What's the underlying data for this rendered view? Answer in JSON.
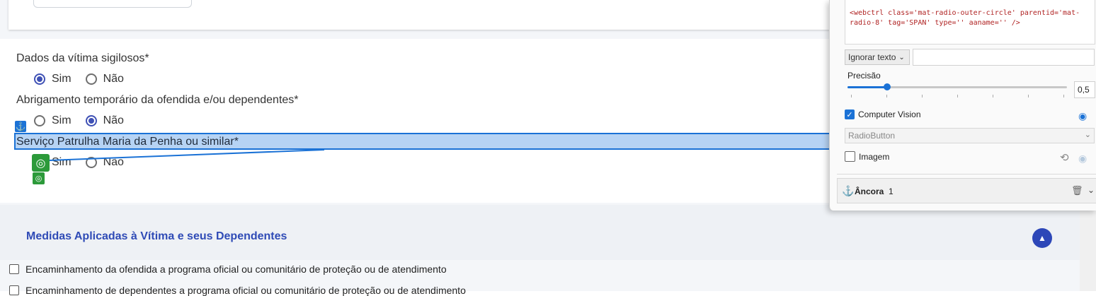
{
  "form": {
    "q1_label": "Dados da vítima sigilosos*",
    "q1_options": [
      "Sim",
      "Não"
    ],
    "q1_selected": "Sim",
    "q2_label": "Abrigamento temporário da ofendida e/ou dependentes*",
    "q2_options": [
      "Sim",
      "Não"
    ],
    "q2_selected": "Não",
    "q3_label": "Serviço Patrulha Maria da Penha ou similar*",
    "q3_options": [
      "Sim",
      "Não"
    ]
  },
  "overlay": {
    "anchor_icon": "anchor-icon",
    "target_icon": "target-icon"
  },
  "section": {
    "title": "Medidas Aplicadas à Vítima e seus Dependentes",
    "collapse_icon": "chevron-up-icon",
    "items": [
      "Encaminhamento da ofendida a programa oficial ou comunitário de proteção ou de atendimento",
      "Encaminhamento de dependentes a programa oficial ou comunitário de proteção ou de atendimento"
    ]
  },
  "panel": {
    "selector": "<webctrl class='mat-radio-outer-circle' parentid='mat-radio-8' tag='SPAN' type='' aaname='' />",
    "ignore_text_label": "Ignorar texto",
    "ignore_text_value": "",
    "precision_label": "Precisão",
    "precision_value": "0,5",
    "precision_fraction": 0.18,
    "cv_label": "Computer Vision",
    "cv_checked": true,
    "control_type": "RadioButton",
    "image_label": "Imagem",
    "image_checked": false,
    "anchor_label": "Âncora",
    "anchor_count": "1"
  },
  "colors": {
    "accent": "#3f51b5",
    "highlight_fill": "#b6d3f4",
    "highlight_border": "#1b72d6",
    "target_green": "#2c9a3a",
    "section_title": "#2f4bb6"
  }
}
